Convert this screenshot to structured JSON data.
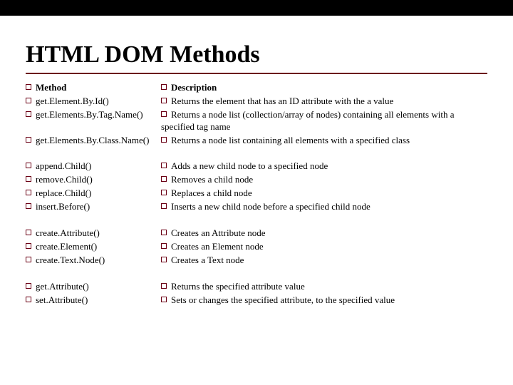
{
  "title": "HTML DOM Methods",
  "headers": {
    "method": "Method",
    "description": "Description"
  },
  "groups": [
    [
      {
        "method": "get.Element.By.Id()",
        "description": "Returns the element that has an ID attribute with the a value"
      },
      {
        "method": "get.Elements.By.Tag.Name()",
        "description": "Returns a node list (collection/array of nodes) containing all elements with a specified tag name"
      },
      {
        "method": "get.Elements.By.Class.Name()",
        "description": "Returns a node list containing all elements with a specified class"
      }
    ],
    [
      {
        "method": "append.Child()",
        "description": "Adds a new child node to a specified node"
      },
      {
        "method": "remove.Child()",
        "description": "Removes a child node"
      },
      {
        "method": "replace.Child()",
        "description": "Replaces a child node"
      },
      {
        "method": "insert.Before()",
        "description": "Inserts a new child node before a specified child node"
      }
    ],
    [
      {
        "method": "create.Attribute()",
        "description": "Creates an Attribute node"
      },
      {
        "method": "create.Element()",
        "description": "Creates an Element node"
      },
      {
        "method": "create.Text.Node()",
        "description": "Creates a Text node"
      }
    ],
    [
      {
        "method": "get.Attribute()",
        "description": "Returns the specified attribute value"
      },
      {
        "method": "set.Attribute()",
        "description": "Sets or changes the specified attribute, to the specified value"
      }
    ]
  ]
}
